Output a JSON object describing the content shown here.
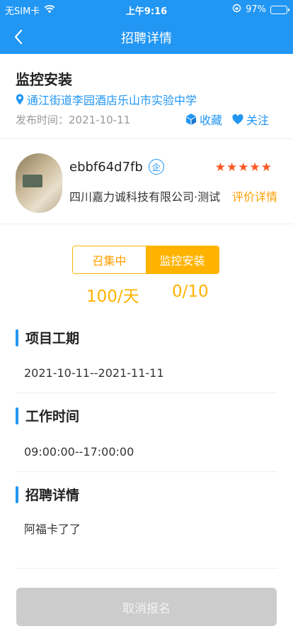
{
  "status_bar": {
    "carrier": "无SIM卡",
    "time": "上午9:16",
    "battery": "97%",
    "battery_level": 0.97
  },
  "nav": {
    "title": "招聘详情",
    "back_icon": "chevron-left-icon"
  },
  "job": {
    "title": "监控安装",
    "location": "通江街道李园酒店乐山市实验中学",
    "publish_time": "发布时间：2021-10-11",
    "favorite_label": "收藏",
    "follow_label": "关注"
  },
  "company": {
    "username": "ebbf64d7fb",
    "badge": "企",
    "rating": 5,
    "name": "四川嘉力诚科技有限公司·测试",
    "review_label": "评价详情"
  },
  "recruit": {
    "status": "召集中",
    "category": "监控安装",
    "price": "100/天",
    "headcount": "0/10"
  },
  "sections": {
    "period_title": "项目工期",
    "period_value": "2021-10-11--2021-11-11",
    "worktime_title": "工作时间",
    "worktime_value": "09:00:00--17:00:00",
    "detail_title": "招聘详情",
    "detail_value": "阿福卡了了"
  },
  "footer": {
    "cancel_label": "取消报名"
  },
  "colors": {
    "primary": "#2196f3",
    "accent": "#ffb300",
    "star": "#ff5722",
    "disabled": "#cccccc"
  }
}
